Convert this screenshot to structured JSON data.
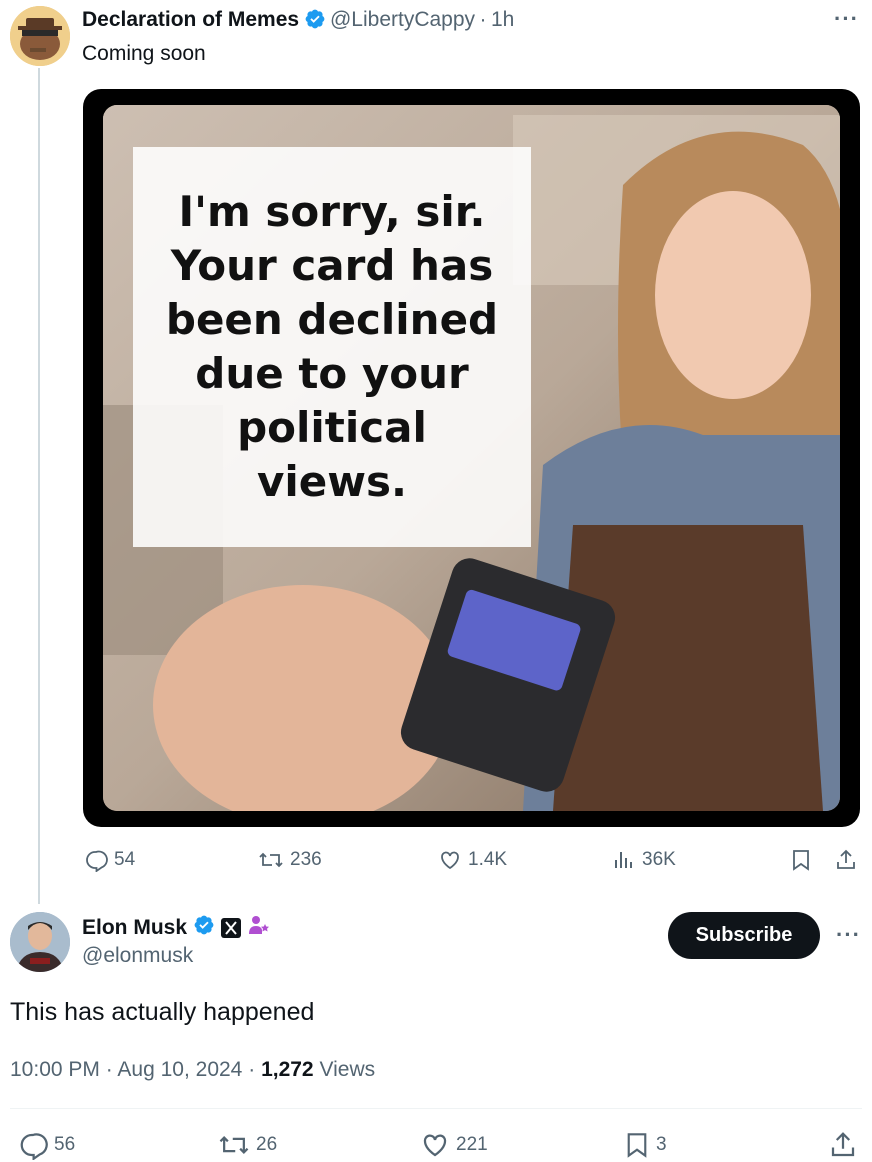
{
  "quoted_tweet": {
    "author_name": "Declaration of Memes",
    "handle": "@LibertyCappy",
    "separator": "·",
    "time": "1h",
    "text": "Coming soon",
    "media": {
      "caption_lines": [
        "I'm sorry, sir.",
        "Your card has",
        "been declined",
        "due to your",
        "political",
        "views."
      ]
    },
    "actions": {
      "replies": "54",
      "reposts": "236",
      "likes": "1.4K",
      "views": "36K"
    }
  },
  "main_tweet": {
    "author_name": "Elon Musk",
    "handle": "@elonmusk",
    "subscribe_label": "Subscribe",
    "text": "This has actually happened",
    "time": "10:00 PM",
    "dot": "·",
    "date": "Aug 10, 2024",
    "view_count": "1,272",
    "views_label": "Views",
    "actions": {
      "replies": "56",
      "reposts": "26",
      "likes": "221",
      "bookmarks": "3"
    }
  },
  "colors": {
    "verified": "#1d9bf0",
    "secondary_text": "#536471",
    "subscribe_bg": "#0f1419",
    "affiliate_purple": "#b04fd1"
  },
  "icons": [
    "more-icon",
    "verified-badge-icon",
    "reply-icon",
    "repost-icon",
    "like-icon",
    "views-icon",
    "bookmark-icon",
    "share-icon",
    "x-logo-icon",
    "affiliate-icon"
  ]
}
